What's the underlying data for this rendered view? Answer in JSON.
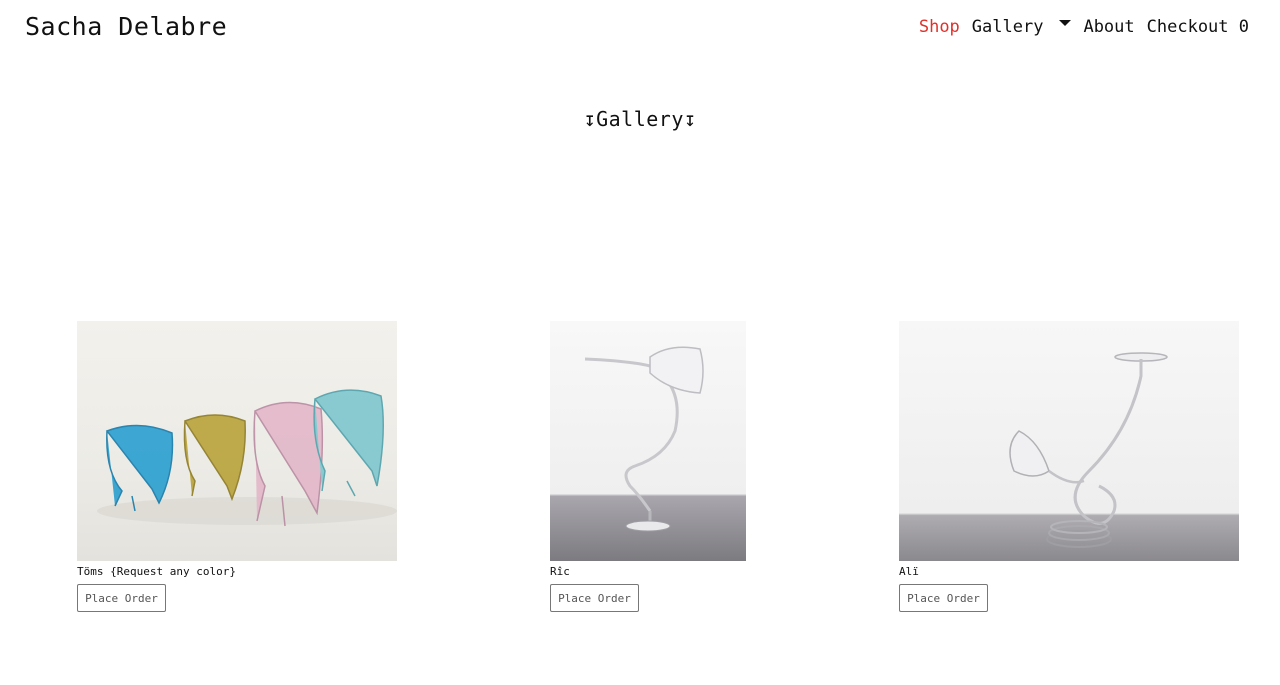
{
  "header": {
    "brand": "Sacha Delabre",
    "nav": {
      "shop": "Shop",
      "gallery": "Gallery",
      "about": "About",
      "checkout": "Checkout 0"
    },
    "active_color": "#e0312b"
  },
  "main": {
    "title": "↧Gallery↧"
  },
  "products": [
    {
      "name": "Töms {Request any color}",
      "button": "Place Order"
    },
    {
      "name": "Rîc",
      "button": "Place Order"
    },
    {
      "name": "Alï",
      "button": "Place Order"
    }
  ]
}
